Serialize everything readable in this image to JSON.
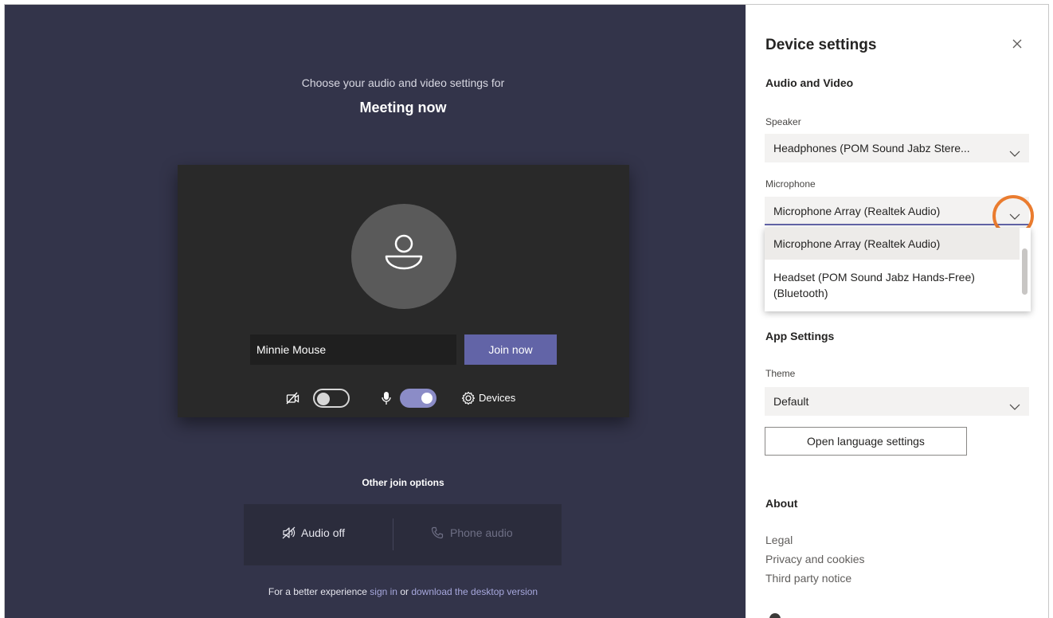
{
  "prejoin": {
    "subtitle": "Choose your audio and video settings for",
    "meeting_title": "Meeting now",
    "name_value": "Minnie Mouse",
    "join_label": "Join now",
    "devices_label": "Devices",
    "camera_enabled": false,
    "mic_enabled": true,
    "other_options_title": "Other join options",
    "audio_off_label": "Audio off",
    "phone_audio_label": "Phone audio",
    "footer": {
      "prefix": "For a better experience ",
      "sign_in": "sign in",
      "middle": " or ",
      "download": "download the desktop version"
    }
  },
  "device_settings": {
    "title": "Device settings",
    "audio_video_heading": "Audio and Video",
    "speaker_label": "Speaker",
    "speaker_value": "Headphones (POM Sound Jabz Stere...",
    "microphone_label": "Microphone",
    "microphone_value": "Microphone Array (Realtek Audio)",
    "microphone_options": [
      "Microphone Array (Realtek Audio)",
      "Headset (POM Sound Jabz Hands-Free) (Bluetooth)"
    ],
    "app_settings_heading": "App Settings",
    "theme_label": "Theme",
    "theme_value": "Default",
    "language_button": "Open language settings",
    "about_heading": "About",
    "about_links": [
      "Legal",
      "Privacy and cookies",
      "Third party notice"
    ]
  },
  "colors": {
    "stage_bg": "#33344a",
    "accent": "#6264a7",
    "highlight": "#ea7c2f"
  },
  "icons": {
    "avatar": "person-icon",
    "camera_off": "video-off-icon",
    "mic": "microphone-icon",
    "devices": "gear-icon",
    "close": "close-icon",
    "chevron": "chevron-down-icon",
    "speaker_off": "speaker-off-icon",
    "phone": "phone-icon"
  }
}
